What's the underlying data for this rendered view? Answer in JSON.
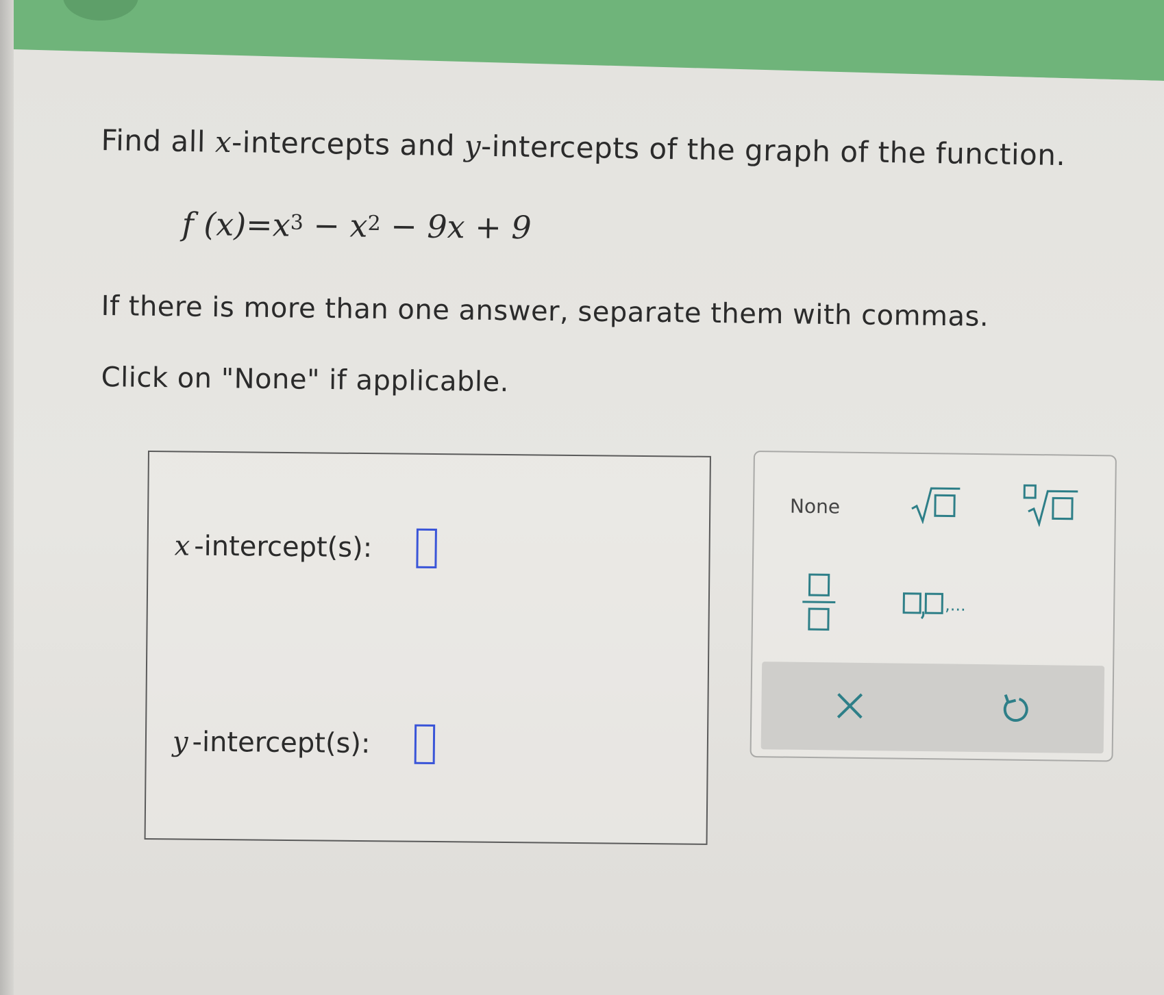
{
  "question": {
    "prefix": "Find all ",
    "x_var": "x",
    "middle": "-intercepts and ",
    "y_var": "y",
    "suffix": "-intercepts of the graph of the function."
  },
  "equation": {
    "lhs": "f (x)",
    "equals": "=",
    "term1_base": "x",
    "term1_exp": "3",
    "term2_sign": "−",
    "term2_base": "x",
    "term2_exp": "2",
    "term3": "− 9x + 9"
  },
  "instructions": {
    "line1": "If there is more than one answer, separate them with commas.",
    "line2": "Click on \"None\" if applicable."
  },
  "answers": {
    "x_var": "x",
    "x_label": "-intercept(s):",
    "x_value": "",
    "y_var": "y",
    "y_label": "-intercept(s):",
    "y_value": ""
  },
  "keypad": {
    "none_label": "None",
    "list_suffix": ",...",
    "icons": {
      "sqrt": "square-root-icon",
      "nroot": "nth-root-icon",
      "fraction": "fraction-icon",
      "list": "list-icon",
      "clear": "close-icon",
      "undo": "undo-icon"
    },
    "colors": {
      "icon": "#2e7f88",
      "input_border": "#3a55d8",
      "banner": "#6fb47a"
    }
  }
}
